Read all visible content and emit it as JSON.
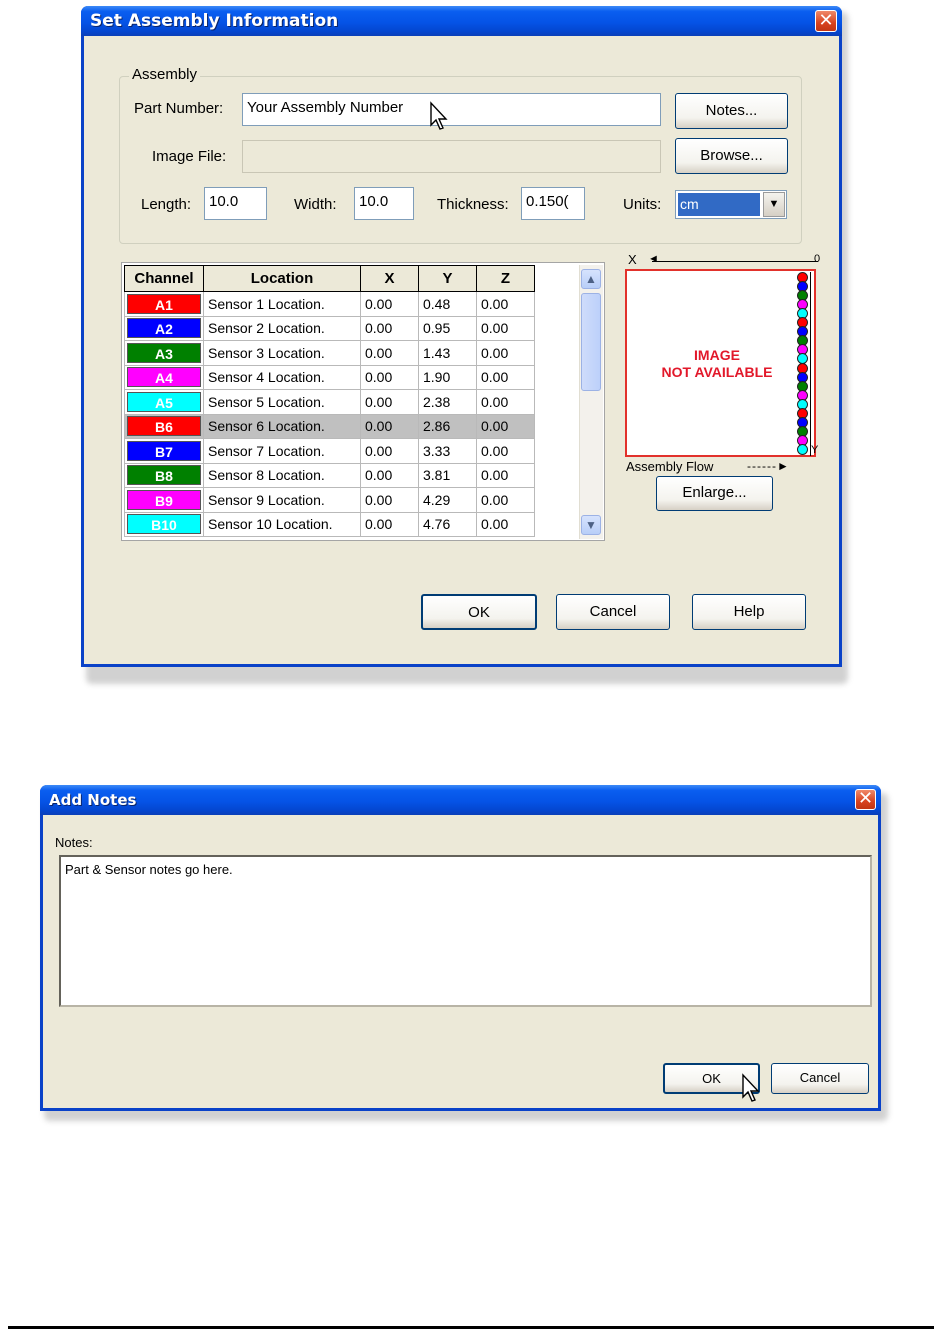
{
  "assembly_dialog": {
    "title": "Set Assembly Information",
    "close_glyph": "✕",
    "group_title": "Assembly",
    "part_number_label": "Part Number:",
    "part_number_value": "Your Assembly Number",
    "image_file_label": "Image File:",
    "image_file_value": "",
    "notes_button": "Notes...",
    "browse_button": "Browse...",
    "length_label": "Length:",
    "length_value": "10.0",
    "width_label": "Width:",
    "width_value": "10.0",
    "thickness_label": "Thickness:",
    "thickness_value": "0.150(",
    "units_label": "Units:",
    "units_value": "cm",
    "table": {
      "columns": [
        "Channel",
        "Location",
        "X",
        "Y",
        "Z"
      ],
      "rows": [
        {
          "channel": "A1",
          "color": "#ff0000",
          "location": "Sensor 1 Location.",
          "x": "0.00",
          "y": "0.48",
          "z": "0.00"
        },
        {
          "channel": "A2",
          "color": "#0000ff",
          "location": "Sensor 2 Location.",
          "x": "0.00",
          "y": "0.95",
          "z": "0.00"
        },
        {
          "channel": "A3",
          "color": "#008000",
          "location": "Sensor 3 Location.",
          "x": "0.00",
          "y": "1.43",
          "z": "0.00"
        },
        {
          "channel": "A4",
          "color": "#ff00ff",
          "location": "Sensor 4 Location.",
          "x": "0.00",
          "y": "1.90",
          "z": "0.00"
        },
        {
          "channel": "A5",
          "color": "#00ffff",
          "location": "Sensor 5 Location.",
          "x": "0.00",
          "y": "2.38",
          "z": "0.00"
        },
        {
          "channel": "B6",
          "color": "#ff0000",
          "location": "Sensor 6 Location.",
          "x": "0.00",
          "y": "2.86",
          "z": "0.00"
        },
        {
          "channel": "B7",
          "color": "#0000ff",
          "location": "Sensor 7 Location.",
          "x": "0.00",
          "y": "3.33",
          "z": "0.00"
        },
        {
          "channel": "B8",
          "color": "#008000",
          "location": "Sensor 8 Location.",
          "x": "0.00",
          "y": "3.81",
          "z": "0.00"
        },
        {
          "channel": "B9",
          "color": "#ff00ff",
          "location": "Sensor 9 Location.",
          "x": "0.00",
          "y": "4.29",
          "z": "0.00"
        },
        {
          "channel": "B10",
          "color": "#00ffff",
          "location": "Sensor 10 Location.",
          "x": "0.00",
          "y": "4.76",
          "z": "0.00"
        }
      ],
      "selected_row": 5
    },
    "preview": {
      "x_axis_label": "X",
      "origin_label": "0",
      "y_axis_label": "Y",
      "no_image_line1": "IMAGE",
      "no_image_line2": "NOT AVAILABLE",
      "flow_label": "Assembly Flow",
      "sensor_dot_colors": [
        "#ff0000",
        "#0000ff",
        "#008000",
        "#ff00ff",
        "#00ffff",
        "#ff0000",
        "#0000ff",
        "#008000",
        "#ff00ff",
        "#00ffff",
        "#ff0000",
        "#0000ff",
        "#008000",
        "#ff00ff",
        "#00ffff",
        "#ff0000",
        "#0000ff",
        "#008000",
        "#ff00ff",
        "#00ffff"
      ]
    },
    "enlarge_button": "Enlarge...",
    "ok_button": "OK",
    "cancel_button": "Cancel",
    "help_button": "Help"
  },
  "notes_dialog": {
    "title": "Add Notes",
    "close_glyph": "✕",
    "notes_label": "Notes:",
    "notes_value": "Part & Sensor notes go here.",
    "ok_button": "OK",
    "cancel_button": "Cancel"
  }
}
